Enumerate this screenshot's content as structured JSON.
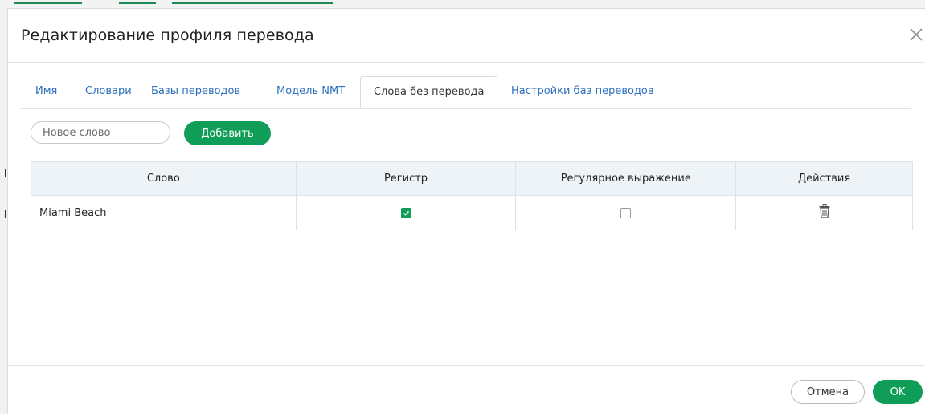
{
  "dialog": {
    "title": "Редактирование профиля перевода"
  },
  "tabs": [
    {
      "label": "Имя",
      "active": false
    },
    {
      "label": "Словари",
      "active": false
    },
    {
      "label": "Базы переводов",
      "active": false
    },
    {
      "label": "Модель NMT",
      "active": false
    },
    {
      "label": "Слова без перевода",
      "active": true
    },
    {
      "label": "Настройки баз переводов",
      "active": false
    }
  ],
  "new_word": {
    "placeholder": "Новое слово",
    "value": "",
    "add_label": "Добавить"
  },
  "table": {
    "columns": [
      "Слово",
      "Регистр",
      "Регулярное выражение",
      "Действия"
    ],
    "rows": [
      {
        "word": "Miami Beach",
        "case_sensitive": true,
        "regex": false,
        "action_icon": "trash-icon"
      }
    ]
  },
  "footer": {
    "cancel_label": "Отмена",
    "ok_label": "OK"
  },
  "colors": {
    "accent": "#0f9d58",
    "link": "#2b6fbd",
    "header_bg": "#eef3f8"
  }
}
